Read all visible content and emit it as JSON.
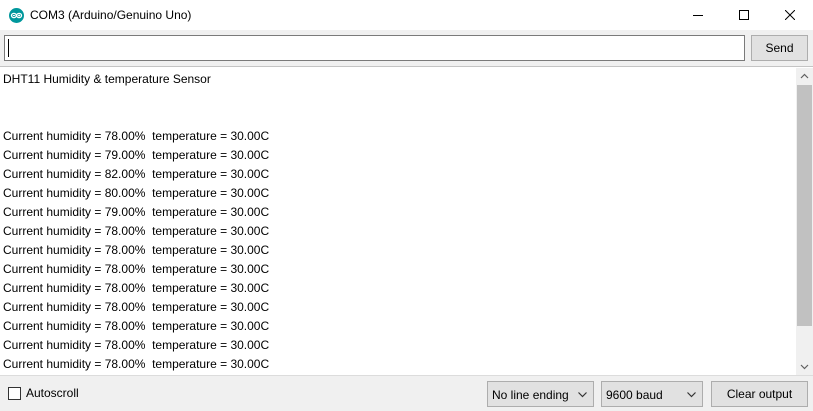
{
  "window": {
    "title": "COM3 (Arduino/Genuino Uno)",
    "app_icon": "arduino-icon",
    "controls": [
      "minimize-icon",
      "maximize-icon",
      "close-icon"
    ]
  },
  "input_bar": {
    "value": "",
    "send_label": "Send"
  },
  "output": {
    "header": "DHT11 Humidity & temperature Sensor",
    "lines": [
      "Current humidity = 78.00%  temperature = 30.00C",
      "Current humidity = 79.00%  temperature = 30.00C",
      "Current humidity = 82.00%  temperature = 30.00C",
      "Current humidity = 80.00%  temperature = 30.00C",
      "Current humidity = 79.00%  temperature = 30.00C",
      "Current humidity = 78.00%  temperature = 30.00C",
      "Current humidity = 78.00%  temperature = 30.00C",
      "Current humidity = 78.00%  temperature = 30.00C",
      "Current humidity = 78.00%  temperature = 30.00C",
      "Current humidity = 78.00%  temperature = 30.00C",
      "Current humidity = 78.00%  temperature = 30.00C",
      "Current humidity = 78.00%  temperature = 30.00C",
      "Current humidity = 78.00%  temperature = 30.00C"
    ]
  },
  "footer": {
    "autoscroll_label": "Autoscroll",
    "autoscroll_checked": false,
    "line_ending": "No line ending",
    "baud": "9600 baud",
    "clear_label": "Clear output"
  },
  "colors": {
    "arduino_teal": "#00979c",
    "panel_bg": "#f0f0f0",
    "button_bg": "#e1e1e1",
    "scroll_thumb": "#c1c1c1"
  }
}
